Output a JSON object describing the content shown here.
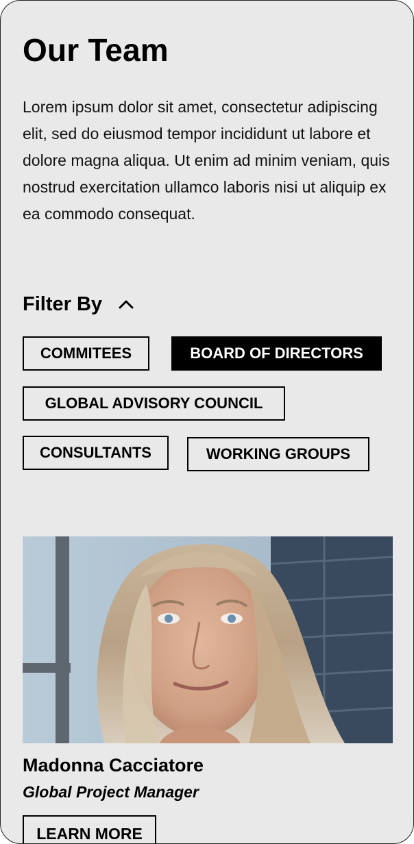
{
  "page": {
    "title": "Our Team",
    "intro": "Lorem ipsum dolor sit amet, consectetur adipiscing elit, sed do eiusmod tempor incididunt ut labore et dolore magna aliqua. Ut enim ad minim veniam, quis nostrud exercitation ullamco laboris nisi ut aliquip ex ea commodo consequat."
  },
  "filter": {
    "label": "Filter By",
    "toggle_icon": "chevron-up-icon",
    "chips": [
      {
        "label": "COMMITEES",
        "active": false
      },
      {
        "label": "BOARD OF DIRECTORS",
        "active": true
      },
      {
        "label": "GLOBAL ADVISORY COUNCIL",
        "active": false
      },
      {
        "label": "CONSULTANTS",
        "active": false
      },
      {
        "label": "WORKING GROUPS",
        "active": false
      }
    ]
  },
  "member": {
    "name": "Madonna Cacciatore",
    "role": "Global Project Manager",
    "button_label": "LEARN MORE"
  },
  "colors": {
    "background": "#e9e9e9",
    "text": "#000000",
    "active_chip_bg": "#000000",
    "active_chip_text": "#ffffff"
  }
}
